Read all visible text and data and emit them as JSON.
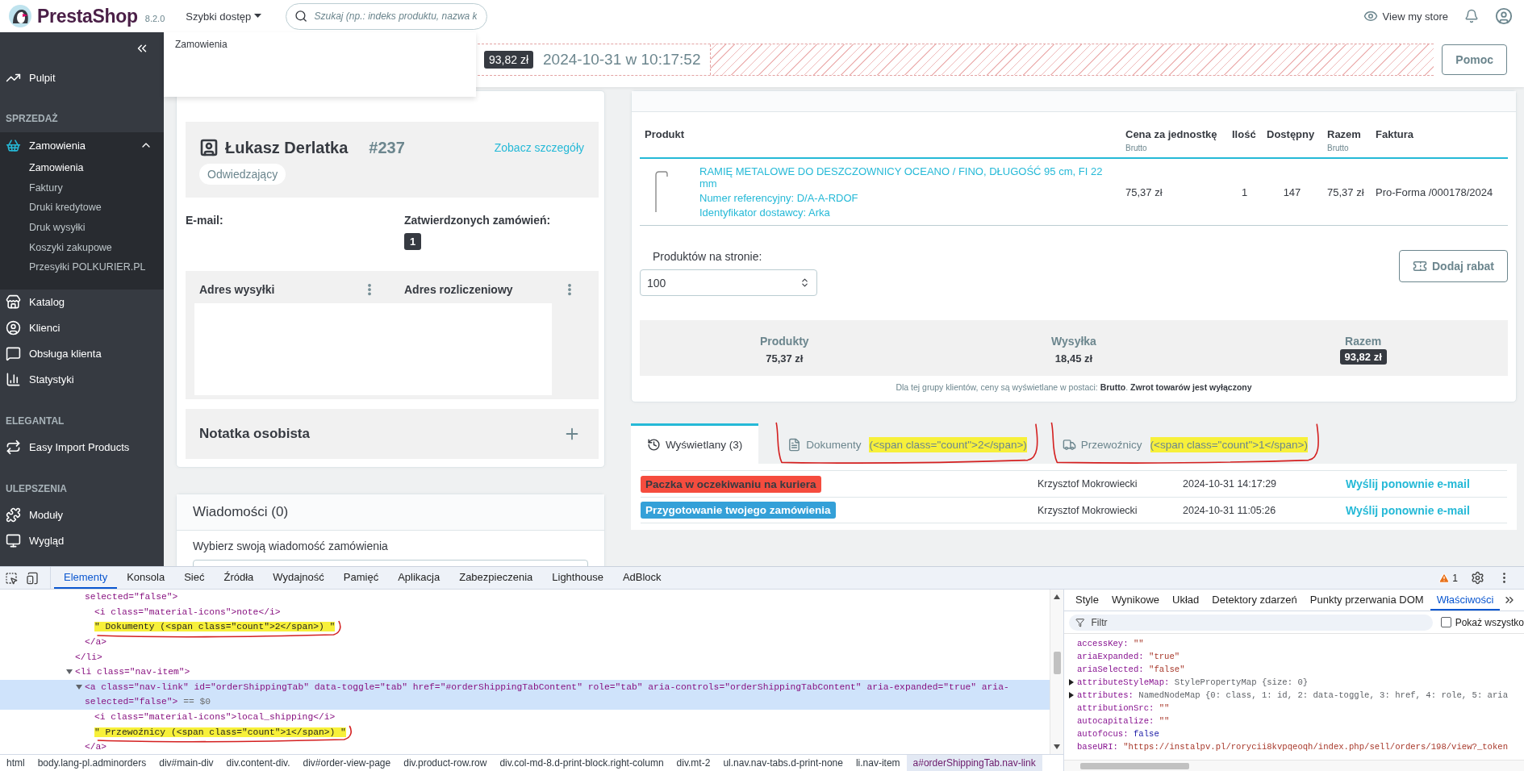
{
  "header": {
    "logo": "PrestaShop",
    "version": "8.2.0",
    "quick_access": {
      "label": "Szybki dostęp",
      "expanded": true,
      "items": [
        "Zamowienia"
      ]
    },
    "search": {
      "placeholder": "Szukaj (np.: indeks produktu, nazwa k"
    },
    "view_store": "View my store"
  },
  "toolbar": {
    "total": "93,82 zł",
    "date": "2024-10-31 w 10:17:52",
    "help_button": "Pomoc"
  },
  "sidebar": {
    "sections": [
      {
        "items": [
          {
            "label": "Pulpit",
            "selected": false
          }
        ]
      },
      {
        "title": "SPRZEDAŻ",
        "items": [
          {
            "label": "Zamowienia",
            "selected": true,
            "expanded": true,
            "children": [
              {
                "label": "Zamowienia",
                "selected": true
              },
              {
                "label": "Faktury",
                "selected": false
              },
              {
                "label": "Druki kredytowe",
                "selected": false
              },
              {
                "label": "Druk wysyłki",
                "selected": false
              },
              {
                "label": "Koszyki zakupowe",
                "selected": false
              },
              {
                "label": "Przesyłki POLKURIER.PL",
                "selected": false
              }
            ]
          },
          {
            "label": "Katalog",
            "selected": false
          },
          {
            "label": "Klienci",
            "selected": false
          },
          {
            "label": "Obsługa klienta",
            "selected": false
          },
          {
            "label": "Statystyki",
            "selected": false
          }
        ]
      },
      {
        "title": "ELEGANTAL",
        "items": [
          {
            "label": "Easy Import Products",
            "selected": false
          }
        ]
      },
      {
        "title": "ULEPSZENIA",
        "items": [
          {
            "label": "Moduły",
            "selected": false
          },
          {
            "label": "Wygląd",
            "selected": false
          }
        ]
      }
    ]
  },
  "customer": {
    "name": "Łukasz Derlatka",
    "number": "#237",
    "details_link": "Zobacz szczegóły",
    "group": "Odwiedzający",
    "email_label": "E-mail:",
    "orders_label": "Zatwierdzonych zamówień:",
    "orders_count": "1",
    "addresses": [
      "Adres wysyłki",
      "Adres rozliczeniowy"
    ],
    "note_title": "Notatka osobista"
  },
  "messages": {
    "title": "Wiadomości (0)",
    "label": "Wybierz swoją wiadomość zamówienia"
  },
  "products": {
    "columns": [
      {
        "label": "Produkt"
      },
      {
        "label": "Cena za jednostkę",
        "sub": "Brutto"
      },
      {
        "label": "Ilość"
      },
      {
        "label": "Dostępny"
      },
      {
        "label": "Razem",
        "sub": "Brutto"
      },
      {
        "label": "Faktura"
      }
    ],
    "rows": [
      {
        "name": "RAMIĘ METALOWE DO DESZCZOWNICY OCEANO / FINO, DŁUGOŚĆ 95 cm, FI 22 mm",
        "reference": "Numer referencyjny: D/A-A-RDOF",
        "supplier": "Identyfikator dostawcy: Arka",
        "price": "75,37 zł",
        "quantity": "1",
        "available": "147",
        "total": "75,37 zł",
        "invoice": "Pro-Forma /000178/2024"
      }
    ],
    "per_page_label": "Produktów na stronie:",
    "per_page": "100",
    "discount_button": "Dodaj rabat",
    "summary": [
      {
        "label": "Produkty",
        "value": "75,37 zł",
        "kind": "plain"
      },
      {
        "label": "Wysyłka",
        "value": "18,45 zł",
        "kind": "plain"
      },
      {
        "label": "Razem",
        "value": "93,82 zł",
        "kind": "badge"
      }
    ],
    "note": "Dla tej grupy klientów, ceny są wyświetlane w postaci: **Brutto**. **Zwrot towarów jest wyłączony**"
  },
  "history": {
    "tabs": [
      {
        "label": "Wyświetlany (3)",
        "selected": true
      },
      {
        "label": "Dokumenty",
        "markup": "(<span class=\"count\">2</span>)",
        "selected": false,
        "highlighted": true,
        "annotated": true
      },
      {
        "label": "Przewoźnicy",
        "markup": "(<span class=\"count\">1</span>)",
        "selected": false,
        "highlighted": true,
        "annotated": true
      }
    ],
    "rows": [
      {
        "status": "Paczka w oczekiwaniu na kuriera",
        "color": "#f54c3e",
        "kind": "dark",
        "employee": "Krzysztof Mokrowiecki",
        "date": "2024-10-31 14:17:29",
        "action": "Wyślij ponownie e-mail"
      },
      {
        "status": "Przygotowanie twojego zamówienia",
        "color": "#34a0d8",
        "kind": "light",
        "employee": "Krzysztof Mokrowiecki",
        "date": "2024-10-31 11:05:26",
        "action": "Wyślij ponownie e-mail"
      }
    ]
  },
  "devtools": {
    "tabs": [
      {
        "label": "Elementy",
        "selected": true
      },
      {
        "label": "Konsola",
        "selected": false
      },
      {
        "label": "Sieć",
        "selected": false
      },
      {
        "label": "Źródła",
        "selected": false
      },
      {
        "label": "Wydajność",
        "selected": false
      },
      {
        "label": "Pamięć",
        "selected": false
      },
      {
        "label": "Aplikacja",
        "selected": false
      },
      {
        "label": "Zabezpieczenia",
        "selected": false
      },
      {
        "label": "Lighthouse",
        "selected": false
      },
      {
        "label": "AdBlock",
        "selected": false
      }
    ],
    "warnings": "1",
    "dom": [
      {
        "children": [
          {
            "kind": "element",
            "selected": false,
            "lines": [
              "selected=\"false\">"
            ],
            "children": [
              {
                "kind": "element",
                "selected": false,
                "lines": [
                  "<i class=\"material-icons\">note</i>"
                ]
              },
              {
                "kind": "text",
                "selected": false,
                "lines": [
                  "\" Dokumenty (<span class=\"count\">2</span>) \""
                ],
                "highlighted": true,
                "annotated": true
              }
            ],
            "close": "</a>"
          }
        ],
        "close": "</li>"
      },
      {
        "kind": "element",
        "selected": false,
        "expanded": true,
        "lines": [
          "<li class=\"nav-item\">"
        ],
        "children": [
          {
            "kind": "element",
            "selected": true,
            "expanded": true,
            "lines": [
              "<a class=\"nav-link\" id=\"orderShippingTab\" data-toggle=\"tab\" href=\"#orderShippingTabContent\" role=\"tab\" aria-controls=\"orderShippingTabContent\" aria-expanded=\"true\" aria-",
              "selected=\"false\">"
            ],
            "suffix": "== $0",
            "children": [
              {
                "kind": "element",
                "selected": false,
                "lines": [
                  "<i class=\"material-icons\">local_shipping</i>"
                ]
              },
              {
                "kind": "text",
                "selected": false,
                "lines": [
                  "\" Przewoźnicy (<span class=\"count\">1</span>) \""
                ],
                "highlighted": true,
                "annotated": true
              }
            ],
            "close": "</a>"
          }
        ]
      }
    ],
    "breadcrumbs": [
      {
        "label": "html",
        "selected": false
      },
      {
        "label": "body.lang-pl.adminorders",
        "selected": false
      },
      {
        "label": "div#main-div",
        "selected": false
      },
      {
        "label": "div.content-div.",
        "selected": false
      },
      {
        "label": "div#order-view-page",
        "selected": false
      },
      {
        "label": "div.product-row.row",
        "selected": false
      },
      {
        "label": "div.col-md-8.d-print-block.right-column",
        "selected": false
      },
      {
        "label": "div.mt-2",
        "selected": false
      },
      {
        "label": "ul.nav.nav-tabs.d-print-none",
        "selected": false
      },
      {
        "label": "li.nav-item",
        "selected": false
      },
      {
        "label": "a#orderShippingTab.nav-link",
        "selected": true
      }
    ],
    "side_tabs": [
      {
        "label": "Style",
        "selected": false
      },
      {
        "label": "Wynikowe",
        "selected": false
      },
      {
        "label": "Układ",
        "selected": false
      },
      {
        "label": "Detektory zdarzeń",
        "selected": false
      },
      {
        "label": "Punkty przerwania DOM",
        "selected": false
      },
      {
        "label": "Właściwości",
        "selected": true
      }
    ],
    "filter": {
      "placeholder": "Filtr"
    },
    "show_all": {
      "label": "Pokaż wszystko",
      "checked": false
    },
    "properties": [
      {
        "name": "accessKey:",
        "value": "\"\"",
        "kind": "string"
      },
      {
        "name": "ariaExpanded:",
        "value": "\"true\"",
        "kind": "string"
      },
      {
        "name": "ariaSelected:",
        "value": "\"false\"",
        "kind": "string"
      },
      {
        "name": "attributeStyleMap:",
        "value": "StylePropertyMap {size: 0}",
        "kind": "object",
        "expanded": false
      },
      {
        "name": "attributes:",
        "value": "NamedNodeMap {0: class, 1: id, 2: data-toggle, 3: href, 4: role, 5: aria",
        "kind": "object",
        "expanded": false
      },
      {
        "name": "attributionSrc:",
        "value": "\"\"",
        "kind": "string"
      },
      {
        "name": "autocapitalize:",
        "value": "\"\"",
        "kind": "string"
      },
      {
        "name": "autofocus:",
        "value": "false",
        "kind": "boolean"
      },
      {
        "name": "baseURI:",
        "value": "\"https://instalpv.pl/rorycii8kvpqeoqh/index.php/sell/orders/198/view?_token",
        "kind": "string"
      }
    ]
  }
}
